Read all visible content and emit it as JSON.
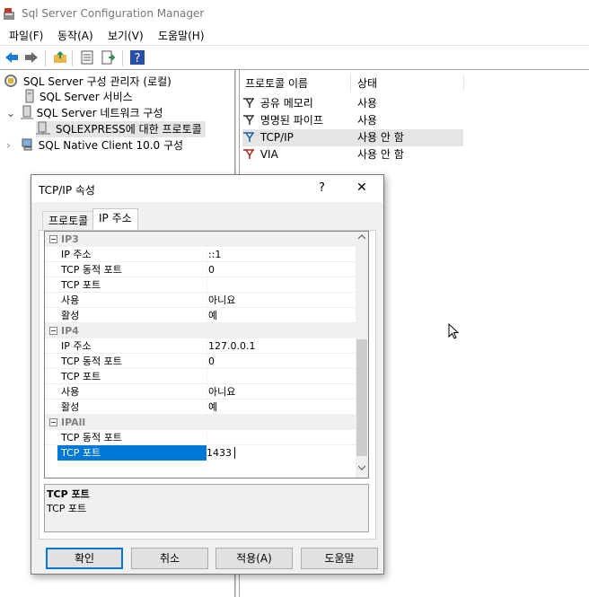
{
  "window": {
    "title": "Sql Server Configuration Manager"
  },
  "menu": [
    "파일(F)",
    "동작(A)",
    "보기(V)",
    "도움말(H)"
  ],
  "tree": {
    "root": "SQL Server 구성 관리자 (로컬)",
    "services": "SQL Server 서비스",
    "network": "SQL Server 네트워크 구성",
    "protocols": "SQLEXPRESS에 대한 프로토콜",
    "native": "SQL Native Client 10.0 구성"
  },
  "list": {
    "headers": [
      "프로토콜 이름",
      "상태"
    ],
    "rows": [
      {
        "name": "공유 메모리",
        "status": "사용"
      },
      {
        "name": "명명된 파이프",
        "status": "사용"
      },
      {
        "name": "TCP/IP",
        "status": "사용 안 함"
      },
      {
        "name": "VIA",
        "status": "사용 안 함"
      }
    ]
  },
  "dialog": {
    "title": "TCP/IP 속성",
    "help_glyph": "?",
    "close_glyph": "✕",
    "tabs": [
      "프로토콜",
      "IP 주소"
    ],
    "grid": [
      {
        "type": "cat",
        "label": "IP3"
      },
      {
        "label": "IP 주소",
        "value": "::1"
      },
      {
        "label": "TCP 동적 포트",
        "value": "0"
      },
      {
        "label": "TCP 포트",
        "value": ""
      },
      {
        "label": "사용",
        "value": "아니요"
      },
      {
        "label": "활성",
        "value": "예"
      },
      {
        "type": "cat",
        "label": "IP4"
      },
      {
        "label": "IP 주소",
        "value": "127.0.0.1"
      },
      {
        "label": "TCP 동적 포트",
        "value": "0"
      },
      {
        "label": "TCP 포트",
        "value": ""
      },
      {
        "label": "사용",
        "value": "아니요"
      },
      {
        "label": "활성",
        "value": "예"
      },
      {
        "type": "cat",
        "label": "IPAll"
      },
      {
        "label": "TCP 동적 포트",
        "value": ""
      },
      {
        "label": "TCP 포트",
        "value": "1433",
        "selected": true
      }
    ],
    "desc_title": "TCP 포트",
    "desc_text": "TCP 포트",
    "buttons": {
      "ok": "확인",
      "cancel": "취소",
      "apply": "적용(A)",
      "help": "도움말"
    }
  }
}
